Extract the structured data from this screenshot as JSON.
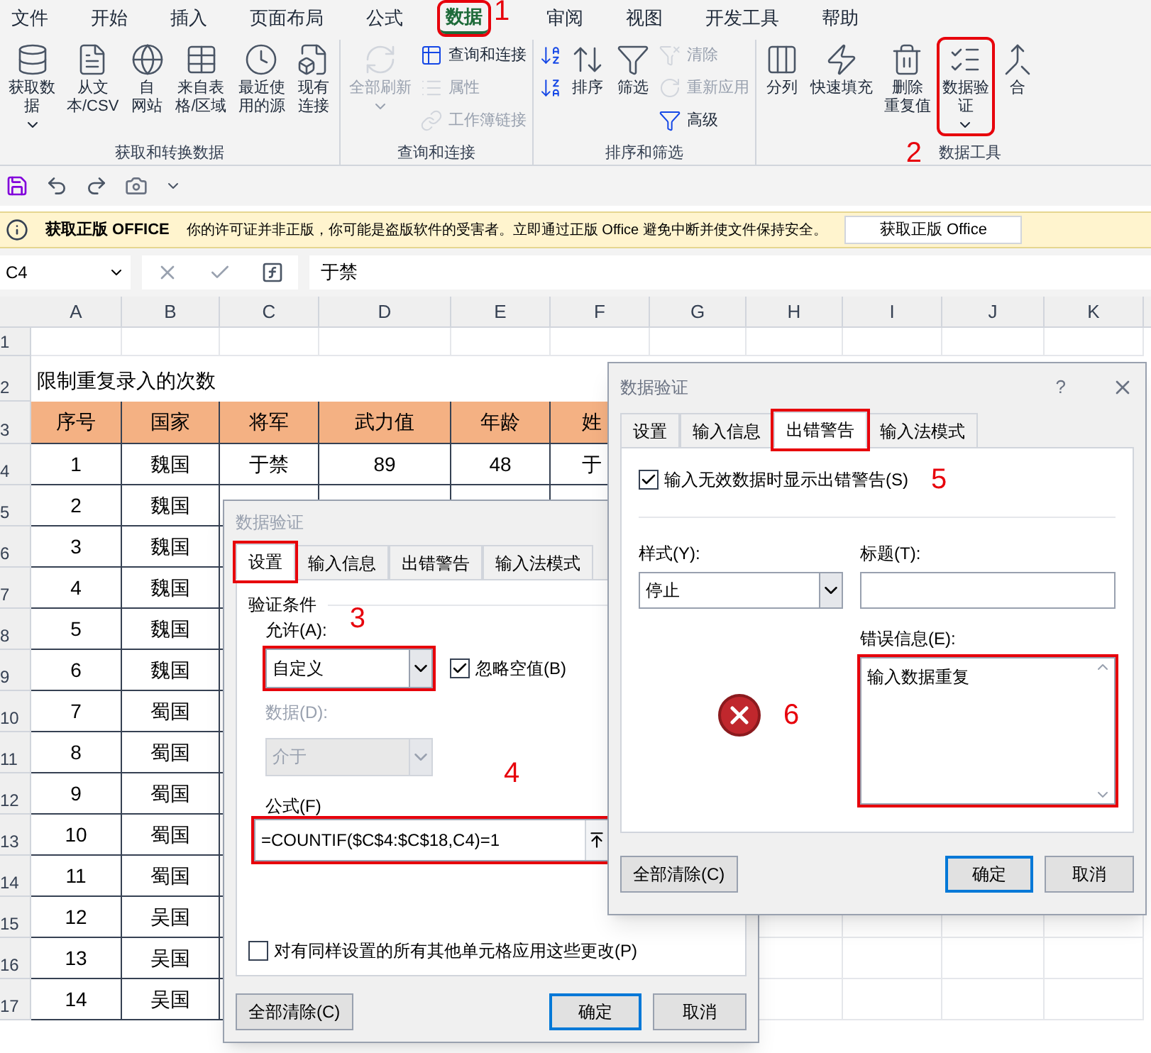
{
  "ribbon": {
    "tabs": [
      {
        "label": "文件",
        "selected": false,
        "highlighted": false
      },
      {
        "label": "开始",
        "selected": false,
        "highlighted": false
      },
      {
        "label": "插入",
        "selected": false,
        "highlighted": false
      },
      {
        "label": "页面布局",
        "selected": false,
        "highlighted": false
      },
      {
        "label": "公式",
        "selected": false,
        "highlighted": false
      },
      {
        "label": "数据",
        "selected": true,
        "highlighted": true,
        "marker": "1"
      },
      {
        "label": "审阅",
        "selected": false,
        "highlighted": false
      },
      {
        "label": "视图",
        "selected": false,
        "highlighted": false
      },
      {
        "label": "开发工具",
        "selected": false,
        "highlighted": false
      },
      {
        "label": "帮助",
        "selected": false,
        "highlighted": false
      }
    ],
    "groups": [
      {
        "label": "获取和转换数据",
        "columns": [
          [
            {
              "label_lines": [
                "获取数",
                "据"
              ],
              "disabled": false,
              "highlighted": false,
              "dropdown": true
            }
          ],
          [
            {
              "label_lines": [
                "从文",
                "本/CSV"
              ],
              "disabled": false,
              "highlighted": false,
              "dropdown": false
            }
          ],
          [
            {
              "label_lines": [
                "自",
                "网站"
              ],
              "disabled": false,
              "highlighted": false,
              "dropdown": false
            }
          ],
          [
            {
              "label_lines": [
                "来自表",
                "格/区域"
              ],
              "disabled": false,
              "highlighted": false,
              "dropdown": false
            }
          ],
          [
            {
              "label_lines": [
                "最近使",
                "用的源"
              ],
              "disabled": false,
              "highlighted": false,
              "dropdown": false
            }
          ],
          [
            {
              "label_lines": [
                "现有",
                "连接"
              ],
              "disabled": false,
              "highlighted": false,
              "dropdown": false
            }
          ]
        ]
      },
      {
        "label": "查询和连接",
        "columns": [
          [
            {
              "label_lines": [
                "全部刷新"
              ],
              "disabled": true,
              "highlighted": false,
              "dropdown": true
            }
          ],
          [
            {
              "label": "查询和连接",
              "disabled": false,
              "highlighted": false,
              "dropdown": false
            },
            {
              "label": "属性",
              "disabled": true,
              "highlighted": false,
              "dropdown": false
            },
            {
              "label": "工作簿链接",
              "disabled": true,
              "highlighted": false,
              "dropdown": false
            }
          ]
        ]
      },
      {
        "label": "排序和筛选",
        "columns": [
          [
            {
              "disabled": false,
              "highlighted": false,
              "dropdown": false
            },
            {
              "disabled": false,
              "highlighted": false,
              "dropdown": false
            }
          ],
          [
            {
              "label_lines": [
                "排序"
              ],
              "disabled": false,
              "highlighted": false,
              "dropdown": false
            }
          ],
          [
            {
              "label_lines": [
                "筛选"
              ],
              "disabled": false,
              "highlighted": false,
              "dropdown": false
            }
          ],
          [
            {
              "label": "清除",
              "disabled": true,
              "highlighted": false,
              "dropdown": false
            },
            {
              "label": "重新应用",
              "disabled": true,
              "highlighted": false,
              "dropdown": false
            },
            {
              "label": "高级",
              "disabled": false,
              "highlighted": false,
              "dropdown": false
            }
          ]
        ]
      },
      {
        "label": "数据工具",
        "marker": "2",
        "columns": [
          [
            {
              "label_lines": [
                "分列"
              ],
              "disabled": false,
              "highlighted": false,
              "dropdown": false
            }
          ],
          [
            {
              "label_lines": [
                "快速填充"
              ],
              "disabled": false,
              "highlighted": false,
              "dropdown": false
            }
          ],
          [
            {
              "label_lines": [
                "删除",
                "重复值"
              ],
              "disabled": false,
              "highlighted": false,
              "dropdown": false
            }
          ],
          [
            {
              "label_lines": [
                "数据验",
                "证"
              ],
              "disabled": false,
              "highlighted": true,
              "dropdown": true
            }
          ],
          [
            {
              "label_lines": [
                "合"
              ],
              "disabled": false,
              "highlighted": false,
              "dropdown": false
            }
          ]
        ]
      }
    ]
  },
  "info_bar": {
    "title": "获取正版 OFFICE",
    "message": "你的许可证并非正版，你可能是盗版软件的受害者。立即通过正版 Office 避免中断并使文件保持安全。",
    "button": "获取正版 Office"
  },
  "formula_bar": {
    "name_box": "C4",
    "value": "于禁"
  },
  "sheet": {
    "columns": [
      "A",
      "B",
      "C",
      "D",
      "E",
      "F",
      "G",
      "H",
      "I",
      "J",
      "K"
    ],
    "rows": [
      {
        "number": "1",
        "kind": "blank"
      },
      {
        "number": "2",
        "kind": "title",
        "title": "限制重复录入的次数"
      },
      {
        "number": "3",
        "kind": "header",
        "cells": [
          "序号",
          "国家",
          "将军",
          "武力值",
          "年龄",
          "姓"
        ]
      },
      {
        "number": "4",
        "kind": "data",
        "cells": [
          "1",
          "魏国",
          "于禁",
          "89",
          "48",
          "于"
        ]
      },
      {
        "number": "5",
        "kind": "data",
        "cells": [
          "2",
          "魏国"
        ]
      },
      {
        "number": "6",
        "kind": "data",
        "cells": [
          "3",
          "魏国"
        ]
      },
      {
        "number": "7",
        "kind": "data",
        "cells": [
          "4",
          "魏国"
        ]
      },
      {
        "number": "8",
        "kind": "data",
        "cells": [
          "5",
          "魏国"
        ]
      },
      {
        "number": "9",
        "kind": "data",
        "cells": [
          "6",
          "魏国"
        ]
      },
      {
        "number": "10",
        "kind": "data",
        "cells": [
          "7",
          "蜀国"
        ]
      },
      {
        "number": "11",
        "kind": "data",
        "cells": [
          "8",
          "蜀国"
        ]
      },
      {
        "number": "12",
        "kind": "data",
        "cells": [
          "9",
          "蜀国"
        ]
      },
      {
        "number": "13",
        "kind": "data",
        "cells": [
          "10",
          "蜀国"
        ]
      },
      {
        "number": "14",
        "kind": "data",
        "cells": [
          "11",
          "蜀国"
        ]
      },
      {
        "number": "15",
        "kind": "data",
        "cells": [
          "12",
          "吴国"
        ]
      },
      {
        "number": "16",
        "kind": "data",
        "cells": [
          "13",
          "吴国"
        ]
      },
      {
        "number": "17",
        "kind": "data",
        "cells": [
          "14",
          "吴国"
        ]
      }
    ]
  },
  "settings_dialog": {
    "title": "数据验证",
    "tabs": [
      {
        "label": "设置",
        "selected": true,
        "highlighted": true
      },
      {
        "label": "输入信息",
        "selected": false,
        "highlighted": false
      },
      {
        "label": "出错警告",
        "selected": false,
        "highlighted": false
      },
      {
        "label": "输入法模式",
        "selected": false,
        "highlighted": false
      }
    ],
    "section": "验证条件",
    "marker_allow": "3",
    "allow_label": "允许(A):",
    "allow_value": "自定义",
    "allow_highlighted": true,
    "ignore_blank": {
      "label": "忽略空值(B)",
      "checked": true
    },
    "data_label": "数据(D):",
    "data_value": "介于",
    "data_disabled": true,
    "marker_formula": "4",
    "formula_label": "公式(F)",
    "formula_value": "=COUNTIF($C$4:$C$18,C4)=1",
    "formula_highlighted": true,
    "apply_all": {
      "label": "对有同样设置的所有其他单元格应用这些更改(P)",
      "checked": false
    },
    "buttons": [
      {
        "label": "全部清除(C)",
        "default": false
      },
      {
        "label": "确定",
        "default": true
      },
      {
        "label": "取消",
        "default": false
      }
    ]
  },
  "error_dialog": {
    "title": "数据验证",
    "help": "?",
    "tabs": [
      {
        "label": "设置",
        "selected": false,
        "highlighted": false
      },
      {
        "label": "输入信息",
        "selected": false,
        "highlighted": false
      },
      {
        "label": "出错警告",
        "selected": true,
        "highlighted": true
      },
      {
        "label": "输入法模式",
        "selected": false,
        "highlighted": false
      }
    ],
    "show_alert": {
      "label": "输入无效数据时显示出错警告(S)",
      "checked": true
    },
    "marker_alert": "5",
    "style_label": "样式(Y):",
    "style_value": "停止",
    "title_label": "标题(T):",
    "message_label": "错误信息(E):",
    "message_value": "输入数据重复",
    "message_highlighted": true,
    "marker_icon": "6",
    "buttons": [
      {
        "label": "全部清除(C)",
        "default": false
      },
      {
        "label": "确定",
        "default": true
      },
      {
        "label": "取消",
        "default": false
      }
    ]
  }
}
